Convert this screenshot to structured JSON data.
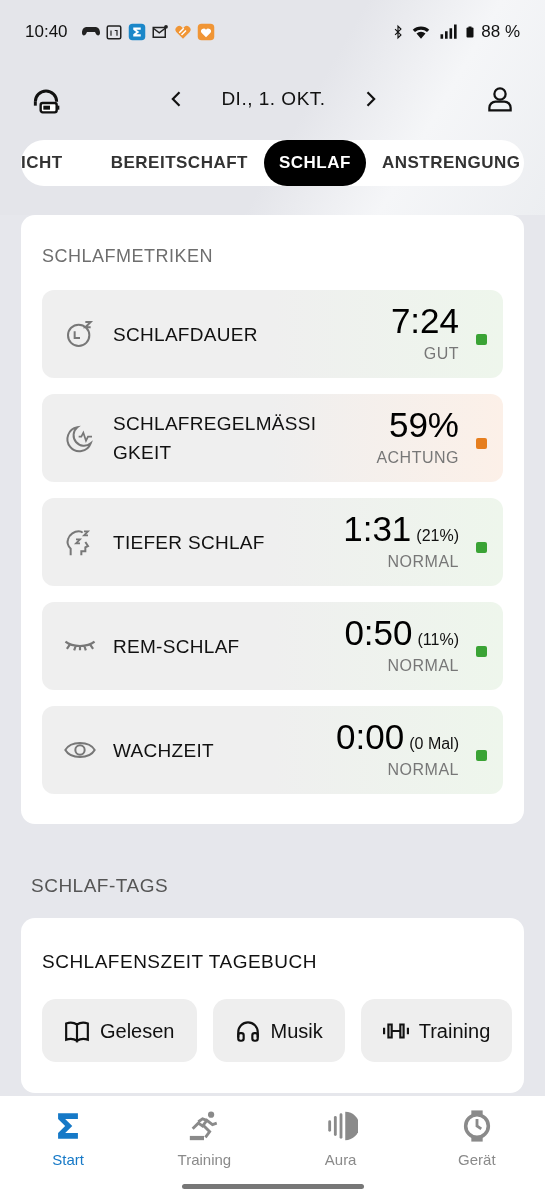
{
  "status_bar": {
    "time": "10:40",
    "battery": "88 %"
  },
  "header": {
    "date": "DI., 1. OKT."
  },
  "tabs": [
    {
      "label": "ICHT",
      "selected": false
    },
    {
      "label": "BEREITSCHAFT",
      "selected": false
    },
    {
      "label": "SCHLAF",
      "selected": true
    },
    {
      "label": "ANSTRENGUNG",
      "selected": false
    }
  ],
  "metrics_card": {
    "title": "SCHLAFMETRIKEN",
    "rows": [
      {
        "kind": "duration",
        "label": "SCHLAFDAUER",
        "value": "7:24",
        "rating": "GUT",
        "color": "#3aa335"
      },
      {
        "kind": "regularity",
        "label": "SCHLAFREGELMÄSSI GKEIT",
        "value": "59%",
        "rating": "ACHTUNG",
        "color": "#e67e1e"
      },
      {
        "kind": "deep",
        "label": "TIEFER SCHLAF",
        "value": "1:31",
        "extra": "(21%)",
        "rating": "NORMAL",
        "color": "#3aa335"
      },
      {
        "kind": "rem",
        "label": "REM-SCHLAF",
        "value": "0:50",
        "extra": "(11%)",
        "rating": "NORMAL",
        "color": "#3aa335"
      },
      {
        "kind": "awake",
        "label": "WACHZEIT",
        "value": "0:00",
        "extra": "(0 Mal)",
        "rating": "NORMAL",
        "color": "#3aa335"
      }
    ]
  },
  "tags_section": {
    "title": "SCHLAF-TAGS",
    "card_title": "SCHLAFENSZEIT TAGEBUCH",
    "chips": [
      {
        "kind": "book",
        "label": "Gelesen"
      },
      {
        "kind": "headphones",
        "label": "Musik"
      },
      {
        "kind": "dumbbell",
        "label": "Training"
      }
    ]
  },
  "bottom_nav": [
    {
      "kind": "start",
      "label": "Start",
      "selected": true
    },
    {
      "kind": "training",
      "label": "Training",
      "selected": false
    },
    {
      "kind": "aura",
      "label": "Aura",
      "selected": false
    },
    {
      "kind": "device",
      "label": "Gerät",
      "selected": false
    }
  ]
}
